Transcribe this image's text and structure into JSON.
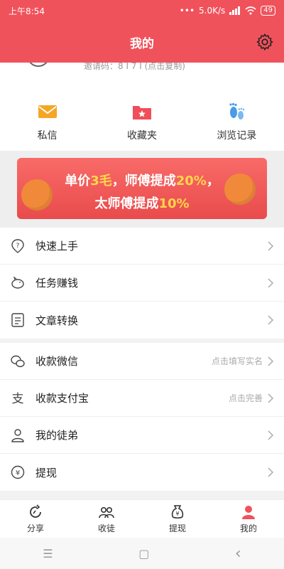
{
  "status_bar": {
    "time": "上午8:54",
    "dots": "•••",
    "speed": "5.0K/s",
    "battery": "49"
  },
  "header": {
    "title": "我的"
  },
  "profile": {
    "invite_text": "邀请码：8 I 7 I (点击复制)"
  },
  "shortcuts": [
    {
      "label": "私信",
      "icon": "mail-icon"
    },
    {
      "label": "收藏夹",
      "icon": "folder-star-icon"
    },
    {
      "label": "浏览记录",
      "icon": "footprints-icon"
    }
  ],
  "banner": {
    "line1_a": "单价",
    "line1_b": "3毛",
    "line1_c": "，师傅提成",
    "line1_d": "20%",
    "line1_e": "，",
    "line2_a": "太师傅提成",
    "line2_b": "10%"
  },
  "menu_group1": [
    {
      "label": "快速上手",
      "icon": "question-pin-icon",
      "hint": ""
    },
    {
      "label": "任务赚钱",
      "icon": "piggy-bank-icon",
      "hint": ""
    },
    {
      "label": "文章转换",
      "icon": "document-icon",
      "hint": ""
    }
  ],
  "menu_group2": [
    {
      "label": "收款微信",
      "icon": "wechat-icon",
      "hint": "点击填写实名"
    },
    {
      "label": "收款支付宝",
      "icon": "alipay-icon",
      "hint": "点击完善"
    },
    {
      "label": "我的徒弟",
      "icon": "person-icon",
      "hint": ""
    },
    {
      "label": "提现",
      "icon": "yen-circle-icon",
      "hint": ""
    }
  ],
  "tabs": [
    {
      "label": "分享",
      "icon": "share-icon",
      "active": false
    },
    {
      "label": "收徒",
      "icon": "people-icon",
      "active": false
    },
    {
      "label": "提现",
      "icon": "yen-bag-icon",
      "active": false
    },
    {
      "label": "我的",
      "icon": "me-icon",
      "active": true
    }
  ],
  "nav": {
    "menu": "☰",
    "home": "▢",
    "back": "‹"
  },
  "colors": {
    "brand": "#f0525c",
    "accent_yellow": "#ffd54a"
  }
}
